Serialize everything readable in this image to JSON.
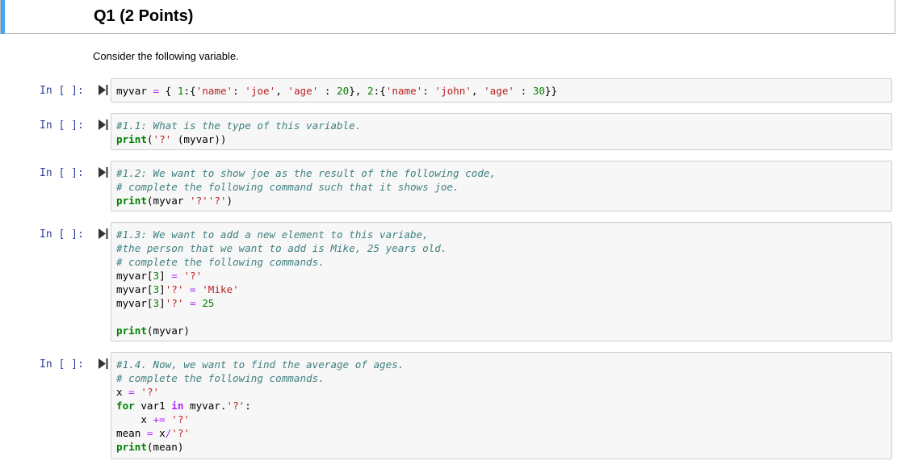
{
  "heading": {
    "title": "Q1 (2 Points)"
  },
  "intro": {
    "text": "Consider the following variable."
  },
  "prompt_label": "In [ ]:",
  "cells": [
    {
      "id": "cell-1",
      "lines": [
        [
          [
            "nm",
            "myvar "
          ],
          [
            "op",
            "="
          ],
          [
            "nm",
            " { "
          ],
          [
            "num",
            "1"
          ],
          [
            "nm",
            ":{"
          ],
          [
            "str",
            "'name'"
          ],
          [
            "nm",
            ": "
          ],
          [
            "str",
            "'joe'"
          ],
          [
            "nm",
            ", "
          ],
          [
            "str",
            "'age'"
          ],
          [
            "nm",
            " : "
          ],
          [
            "num",
            "20"
          ],
          [
            "nm",
            "}, "
          ],
          [
            "num",
            "2"
          ],
          [
            "nm",
            ":{"
          ],
          [
            "str",
            "'name'"
          ],
          [
            "nm",
            ": "
          ],
          [
            "str",
            "'john'"
          ],
          [
            "nm",
            ", "
          ],
          [
            "str",
            "'age'"
          ],
          [
            "nm",
            " : "
          ],
          [
            "num",
            "30"
          ],
          [
            "nm",
            "}}"
          ]
        ]
      ]
    },
    {
      "id": "cell-2",
      "lines": [
        [
          [
            "cm",
            "#1.1: What is the type of this variable."
          ]
        ],
        [
          [
            "kw",
            "print"
          ],
          [
            "nm",
            "("
          ],
          [
            "str",
            "'?'"
          ],
          [
            "nm",
            " (myvar))"
          ]
        ]
      ]
    },
    {
      "id": "cell-3",
      "lines": [
        [
          [
            "cm",
            "#1.2: We want to show joe as the result of the following code,"
          ]
        ],
        [
          [
            "cm",
            "# complete the following command such that it shows joe."
          ]
        ],
        [
          [
            "kw",
            "print"
          ],
          [
            "nm",
            "(myvar "
          ],
          [
            "str",
            "'?''?'"
          ],
          [
            "nm",
            ")"
          ]
        ]
      ]
    },
    {
      "id": "cell-4",
      "lines": [
        [
          [
            "cm",
            "#1.3: We want to add a new element to this variabe,"
          ]
        ],
        [
          [
            "cm",
            "#the person that we want to add is Mike, 25 years old."
          ]
        ],
        [
          [
            "cm",
            "# complete the following commands."
          ]
        ],
        [
          [
            "nm",
            "myvar["
          ],
          [
            "num",
            "3"
          ],
          [
            "nm",
            "] "
          ],
          [
            "op",
            "="
          ],
          [
            "nm",
            " "
          ],
          [
            "str",
            "'?'"
          ]
        ],
        [
          [
            "nm",
            "myvar["
          ],
          [
            "num",
            "3"
          ],
          [
            "nm",
            "]"
          ],
          [
            "str",
            "'?'"
          ],
          [
            "nm",
            " "
          ],
          [
            "op",
            "="
          ],
          [
            "nm",
            " "
          ],
          [
            "str",
            "'Mike'"
          ]
        ],
        [
          [
            "nm",
            "myvar["
          ],
          [
            "num",
            "3"
          ],
          [
            "nm",
            "]"
          ],
          [
            "str",
            "'?'"
          ],
          [
            "nm",
            " "
          ],
          [
            "op",
            "="
          ],
          [
            "nm",
            " "
          ],
          [
            "num",
            "25"
          ]
        ],
        [],
        [
          [
            "kw",
            "print"
          ],
          [
            "nm",
            "(myvar)"
          ]
        ]
      ]
    },
    {
      "id": "cell-5",
      "lines": [
        [
          [
            "cm",
            "#1.4. Now, we want to find the average of ages."
          ]
        ],
        [
          [
            "cm",
            "# complete the following commands."
          ]
        ],
        [
          [
            "nm",
            "x "
          ],
          [
            "op",
            "="
          ],
          [
            "nm",
            " "
          ],
          [
            "str",
            "'?'"
          ]
        ],
        [
          [
            "kw",
            "for"
          ],
          [
            "nm",
            " var1 "
          ],
          [
            "ow",
            "in"
          ],
          [
            "nm",
            " myvar."
          ],
          [
            "str",
            "'?'"
          ],
          [
            "nm",
            ":"
          ]
        ],
        [
          [
            "nm",
            "    x "
          ],
          [
            "op",
            "+="
          ],
          [
            "nm",
            " "
          ],
          [
            "str",
            "'?'"
          ]
        ],
        [
          [
            "nm",
            "mean "
          ],
          [
            "op",
            "="
          ],
          [
            "nm",
            " x"
          ],
          [
            "op",
            "/"
          ],
          [
            "str",
            "'?'"
          ]
        ],
        [
          [
            "kw",
            "print"
          ],
          [
            "nm",
            "(mean)"
          ]
        ]
      ]
    }
  ]
}
